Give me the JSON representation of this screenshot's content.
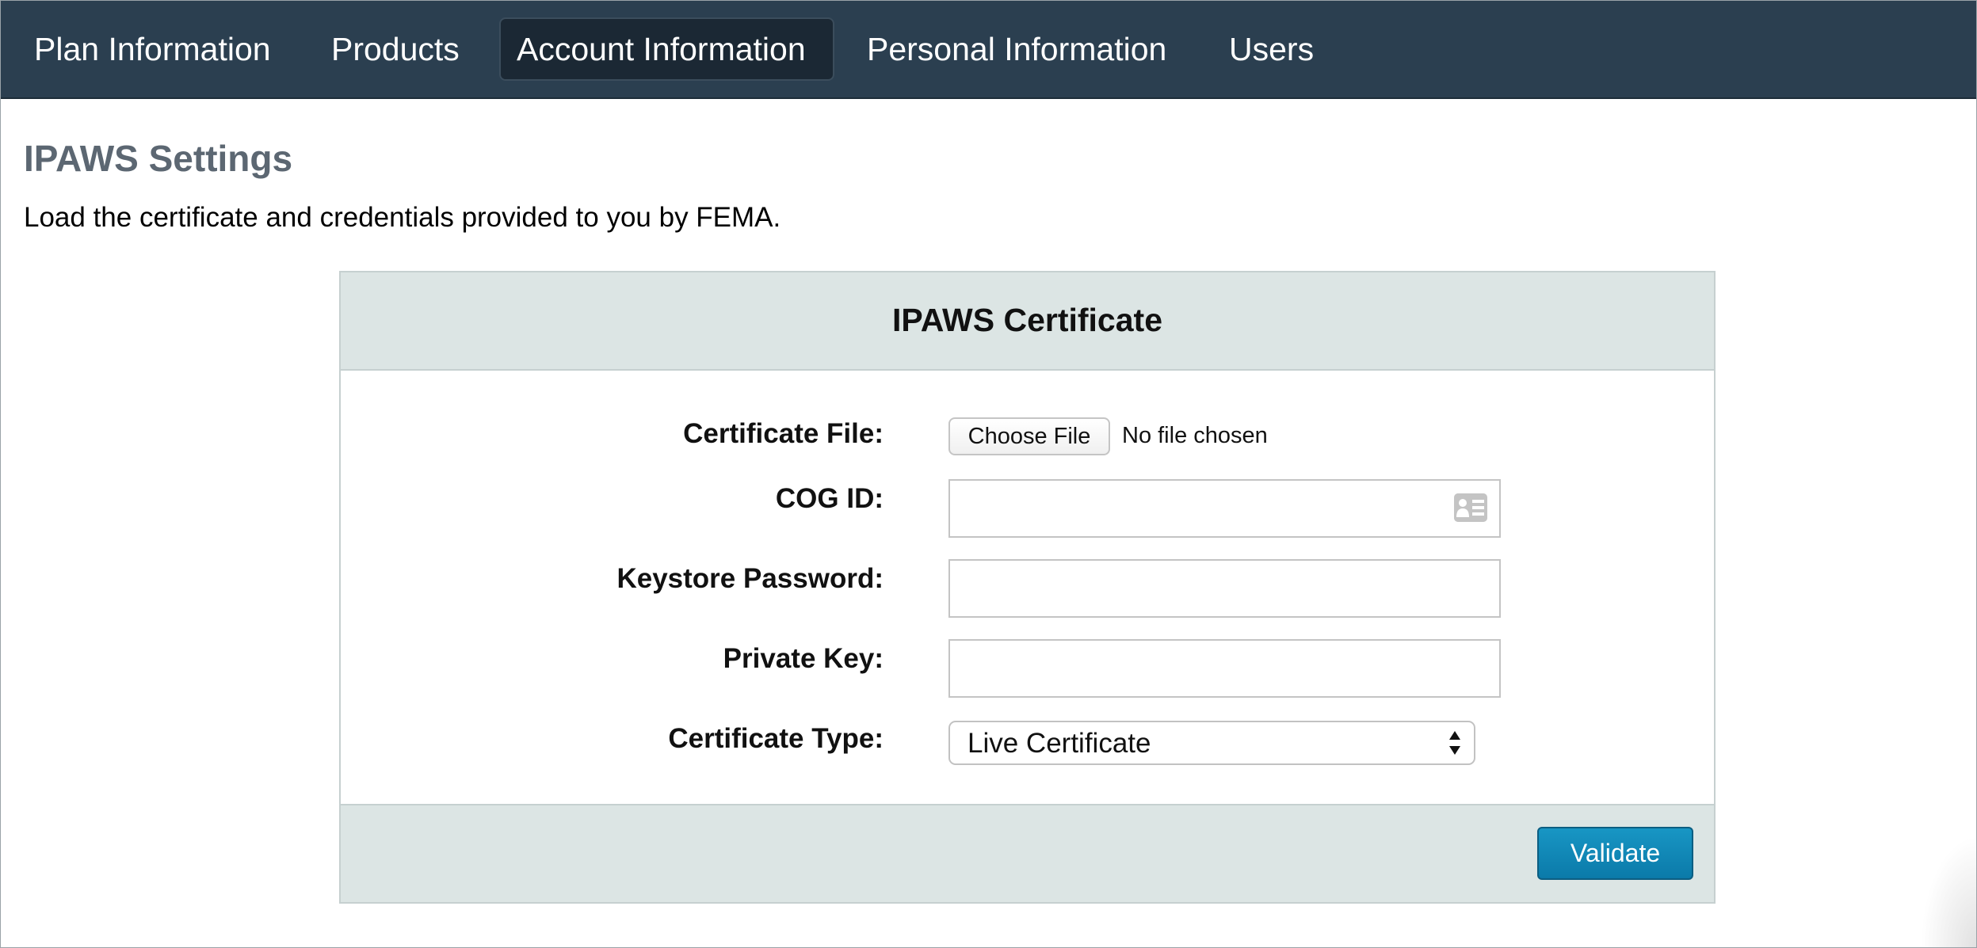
{
  "nav": {
    "tabs": [
      {
        "label": "Plan Information",
        "active": false
      },
      {
        "label": "Products",
        "active": false
      },
      {
        "label": "Account Information",
        "active": true
      },
      {
        "label": "Personal Information",
        "active": false
      },
      {
        "label": "Users",
        "active": false
      }
    ]
  },
  "page": {
    "title": "IPAWS Settings",
    "description": "Load the certificate and credentials provided to you by FEMA."
  },
  "panel": {
    "title": "IPAWS Certificate",
    "fields": {
      "certificate_file": {
        "label": "Certificate File:",
        "button_label": "Choose File",
        "status": "No file chosen"
      },
      "cog_id": {
        "label": "COG ID:",
        "value": "",
        "icon": "contact-card-icon"
      },
      "keystore_password": {
        "label": "Keystore Password:",
        "value": ""
      },
      "private_key": {
        "label": "Private Key:",
        "value": ""
      },
      "certificate_type": {
        "label": "Certificate Type:",
        "selected": "Live Certificate"
      }
    },
    "validate_label": "Validate"
  },
  "colors": {
    "nav_bg": "#2b3f50",
    "nav_active_bg": "#1b2834",
    "title_gray": "#5c6772",
    "panel_band": "#dce5e4",
    "button_blue": "#1189b8"
  }
}
